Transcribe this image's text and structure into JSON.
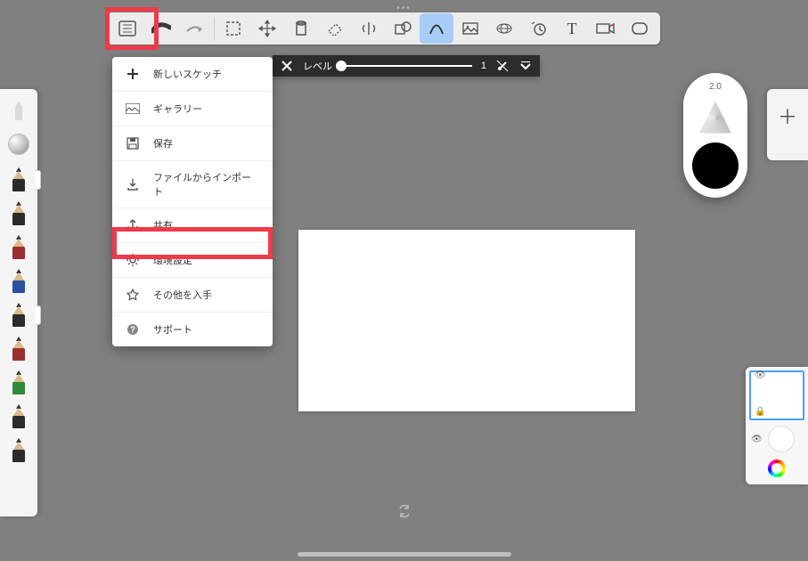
{
  "toolbar": {
    "items": [
      {
        "name": "menu-icon"
      },
      {
        "name": "brush-stroke-icon"
      },
      {
        "name": "redo-arrow-icon"
      },
      {
        "name": "selection-icon"
      },
      {
        "name": "move-icon"
      },
      {
        "name": "fill-icon"
      },
      {
        "name": "eraser-icon"
      },
      {
        "name": "symmetry-icon"
      },
      {
        "name": "shape-icon"
      },
      {
        "name": "curve-icon",
        "active": true
      },
      {
        "name": "image-icon"
      },
      {
        "name": "perspective-icon"
      },
      {
        "name": "timelapse-icon"
      },
      {
        "name": "text-icon"
      },
      {
        "name": "camera-icon"
      },
      {
        "name": "fullscreen-icon"
      }
    ]
  },
  "menu": {
    "items": [
      {
        "icon": "plus-icon",
        "label": "新しいスケッチ"
      },
      {
        "icon": "gallery-icon",
        "label": "ギャラリー"
      },
      {
        "icon": "save-icon",
        "label": "保存"
      },
      {
        "icon": "import-icon",
        "label": "ファイルからインポート"
      },
      {
        "icon": "share-icon",
        "label": "共有"
      },
      {
        "icon": "gear-icon",
        "label": "環境設定"
      },
      {
        "icon": "star-icon",
        "label": "その他を入手"
      },
      {
        "icon": "help-icon",
        "label": "サポート"
      }
    ]
  },
  "level_bar": {
    "label": "レベル",
    "value": "1"
  },
  "puck": {
    "size_label": "2.0"
  },
  "brushes": {
    "colors": [
      "#2b2b2b",
      "#2b2b2b",
      "#9a2f2f",
      "#2a4fa3",
      "#2b2b2b",
      "#9a2f2f",
      "#2f8a3a",
      "#2b2b2b",
      "#2b2b2b"
    ]
  }
}
